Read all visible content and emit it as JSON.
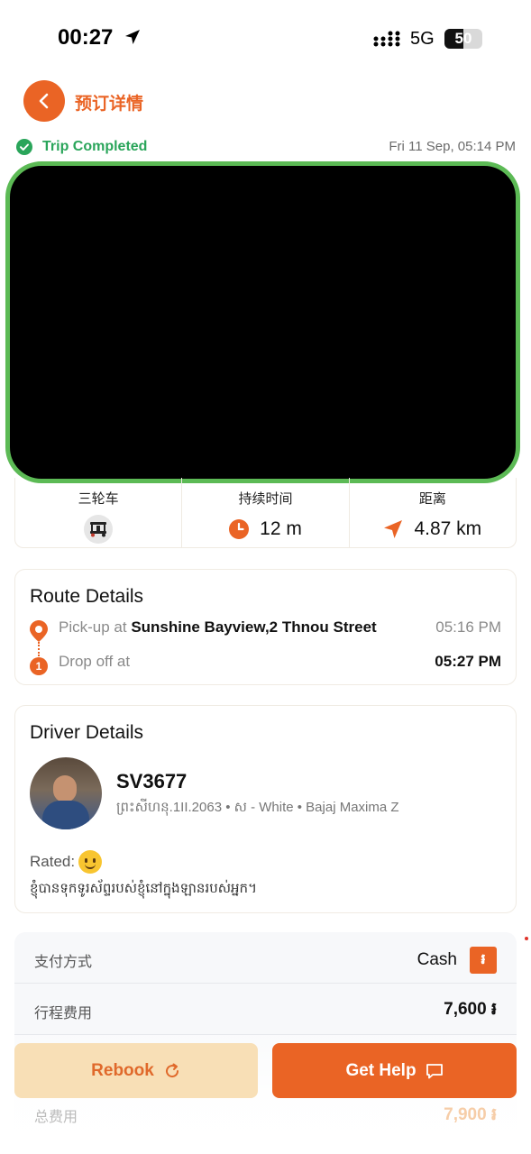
{
  "status_bar": {
    "time": "00:27",
    "network": "5G",
    "battery": "50",
    "battery_level": 0.5
  },
  "header": {
    "title": "预订详情"
  },
  "trip": {
    "status": "Trip Completed",
    "date": "Fri 11 Sep, 05:14 PM"
  },
  "stats": {
    "vehicle_label": "三轮车",
    "duration_label": "持续时间",
    "duration_value": "12 m",
    "distance_label": "距离",
    "distance_value": "4.87 km"
  },
  "route": {
    "title": "Route Details",
    "pickup_prefix": "Pick-up at ",
    "pickup_place": "Sunshine Bayview,2 Thnou Street",
    "pickup_time": "05:16 PM",
    "dropoff_marker": "1",
    "dropoff_prefix": "Drop off at",
    "dropoff_time": "05:27 PM"
  },
  "driver": {
    "title": "Driver Details",
    "plate": "SV3677",
    "vehicle_info": "ព្រះសីហនុ.1II.2063 • ស - White • Bajaj Maxima Z",
    "rated_label": "Rated:",
    "comment": "ខ្ញុំបានទុកទូរស័ព្ទរបស់ខ្ញុំនៅក្នុងឡានរបស់អ្នក។"
  },
  "payment": {
    "method_label": "支付方式",
    "method_value": "Cash",
    "currency_symbol": "៛",
    "fare_label": "行程费用",
    "fare_value": "7,600 ៛",
    "total_label": "总费用",
    "total_value": "7,900 ៛"
  },
  "actions": {
    "rebook_label": "Rebook",
    "help_label": "Get Help"
  },
  "colors": {
    "accent": "#ea6425",
    "success": "#2aa55a",
    "map_border": "#5cba55"
  }
}
